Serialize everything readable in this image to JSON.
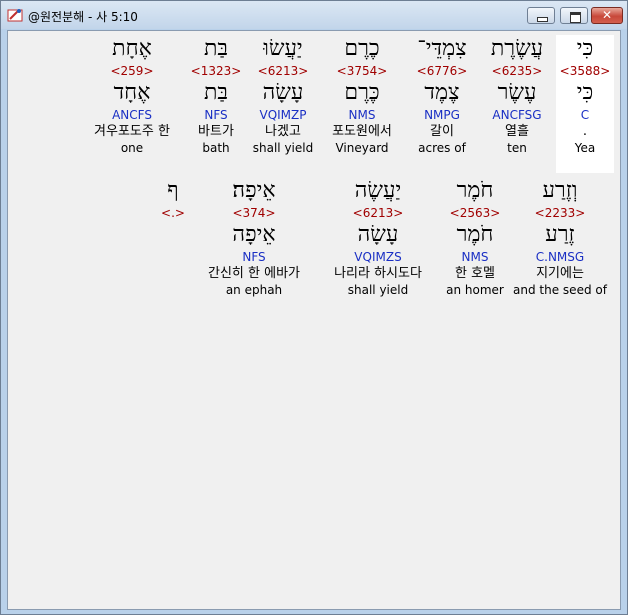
{
  "window": {
    "title": "@원전분해 - 사 5:10",
    "buttons": {
      "minimize": "minimize",
      "maximize": "maximize",
      "close": "close"
    }
  },
  "rows": [
    {
      "words": [
        {
          "heb": "כִּי",
          "strong": "<3588>",
          "lemma": "כִּי",
          "morph": "C",
          "kor": ".",
          "eng": "Yea",
          "highlight": true
        },
        {
          "heb": "עֲשֶׂרֶת",
          "strong": "<6235>",
          "lemma": "עֶשֶׂר",
          "morph": "ANCFSG",
          "kor": "열흘",
          "eng": "ten",
          "highlight": false
        },
        {
          "heb": "צִמְדֵּי־",
          "strong": "<6776>",
          "lemma": "צֶמֶד",
          "morph": "NMPG",
          "kor": "갈이",
          "eng": "acres of",
          "highlight": false
        },
        {
          "heb": "כֶרֶם",
          "strong": "<3754>",
          "lemma": "כֶּרֶם",
          "morph": "NMS",
          "kor": "포도원에서",
          "eng": "Vineyard",
          "highlight": false
        },
        {
          "heb": "יַעֲשׂוּ",
          "strong": "<6213>",
          "lemma": "עָשָׂה",
          "morph": "VQIMZP",
          "kor": "나겠고",
          "eng": "shall yield",
          "highlight": false
        },
        {
          "heb": "בַּת",
          "strong": "<1323>",
          "lemma": "בַּת",
          "morph": "NFS",
          "kor": "바트가",
          "eng": "bath",
          "highlight": false
        },
        {
          "heb": "אֶחָת",
          "strong": "<259>",
          "lemma": "אֶחָד",
          "morph": "ANCFS",
          "kor": "겨우포도주 한",
          "eng": "one",
          "highlight": false
        }
      ]
    },
    {
      "words": [
        {
          "heb": "וְזֶרַע",
          "strong": "<2233>",
          "lemma": "זֶרַע",
          "morph": "C.NMSG",
          "kor": "지기에는",
          "eng": "and the seed of",
          "highlight": false
        },
        {
          "heb": "חֹמֶר",
          "strong": "<2563>",
          "lemma": "חֹמֶר",
          "morph": "NMS",
          "kor": "한 호멜",
          "eng": "an homer",
          "highlight": false
        },
        {
          "heb": "יַעֲשֶׂה",
          "strong": "<6213>",
          "lemma": "עָשָׂה",
          "morph": "VQIMZS",
          "kor": "나리라 하시도다",
          "eng": "shall yield",
          "highlight": false
        },
        {
          "heb": "אֵיפָה׃",
          "strong": "<374>",
          "lemma": "אֵיפָה",
          "morph": "NFS",
          "kor": "간신히 한 에바가",
          "eng": "an ephah",
          "highlight": false
        },
        {
          "heb": "ף",
          "strong": "<.>",
          "lemma": "",
          "morph": "",
          "kor": "",
          "eng": "",
          "highlight": false
        }
      ]
    }
  ]
}
